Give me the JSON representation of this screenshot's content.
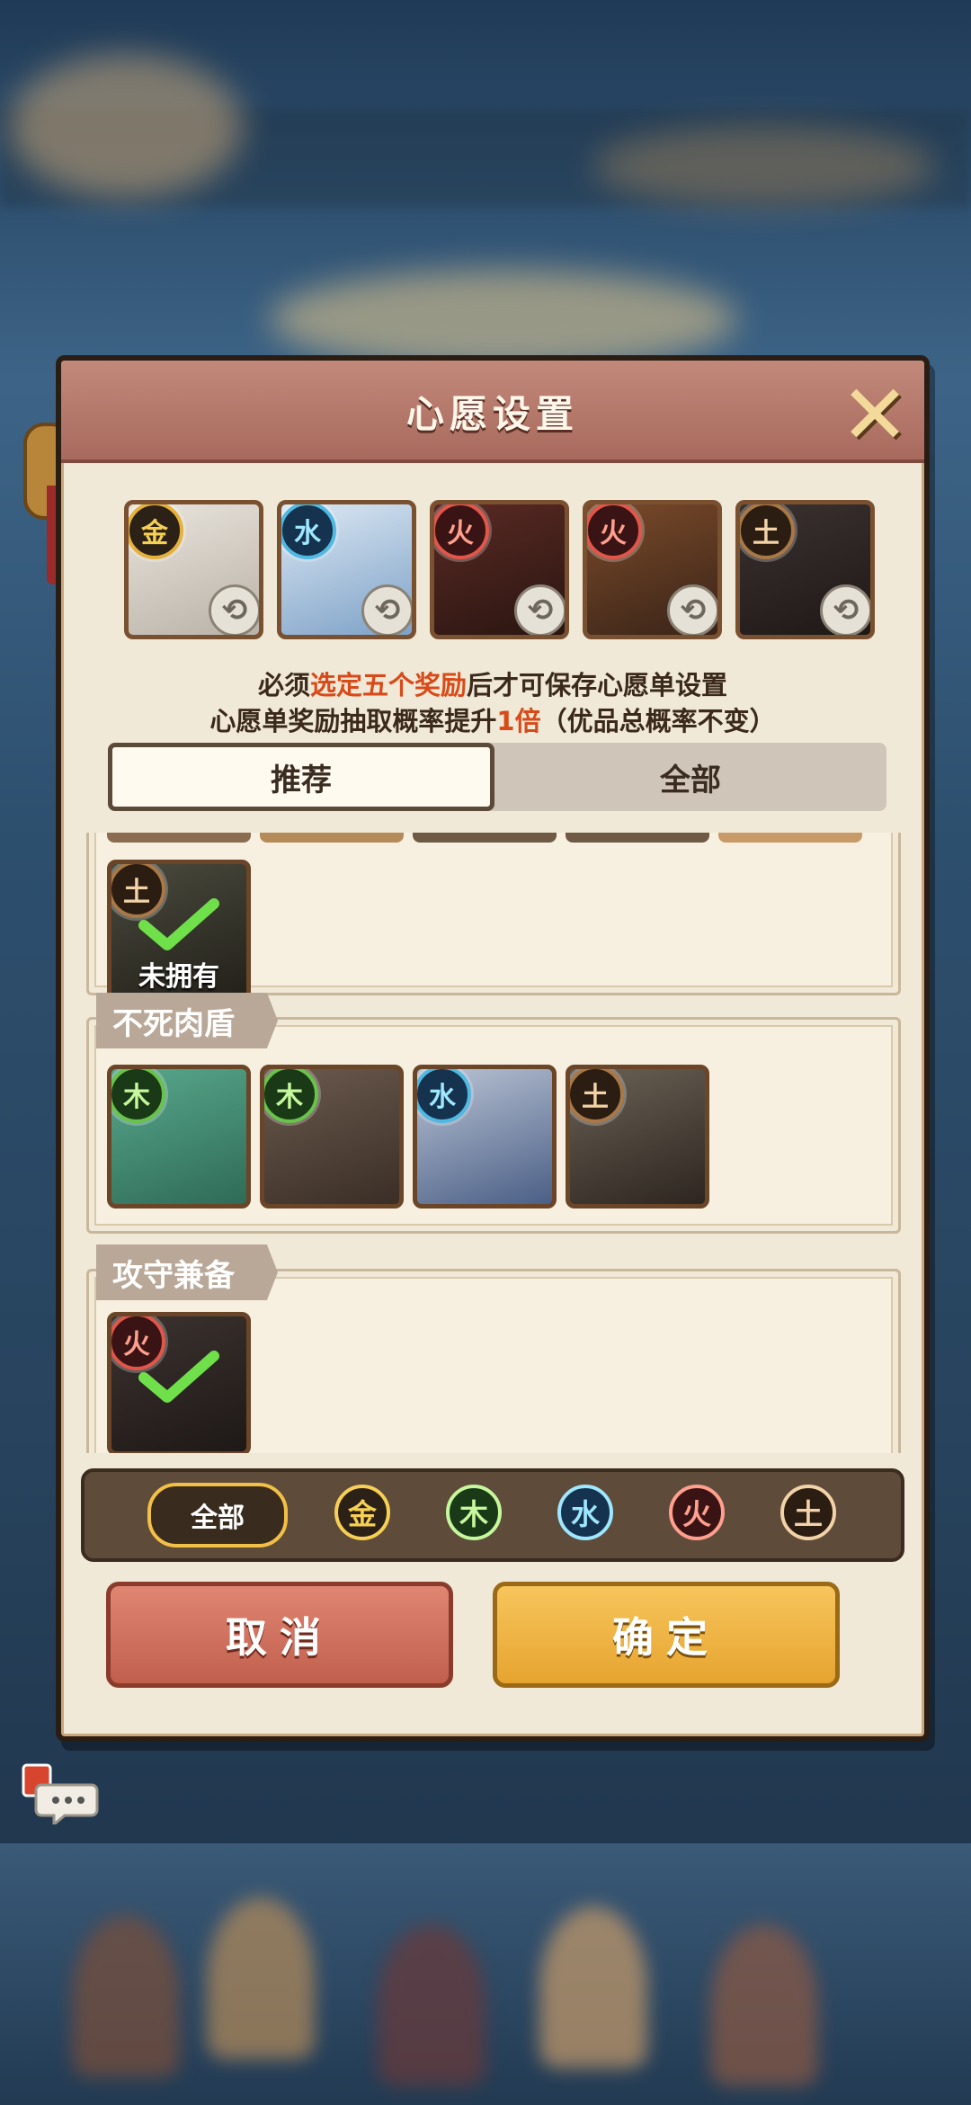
{
  "dialog": {
    "title": "心愿设置",
    "notice_line1_a": "必须",
    "notice_line1_hl": "选定五个奖励",
    "notice_line1_b": "后才可保存心愿单设置",
    "notice_line2_a": "心愿单奖励抽取概率提升",
    "notice_line2_hl": "1倍",
    "notice_line2_b": "（优品总概率不变）"
  },
  "selected_slots": [
    {
      "element": "金",
      "element_key": "gold",
      "colors": [
        "#e9e4dc",
        "#b9b2a8"
      ]
    },
    {
      "element": "水",
      "element_key": "water",
      "colors": [
        "#dce8f3",
        "#7da1c7"
      ]
    },
    {
      "element": "火",
      "element_key": "fire",
      "colors": [
        "#5a2a24",
        "#2a1511"
      ]
    },
    {
      "element": "火",
      "element_key": "fire",
      "colors": [
        "#7a4a2a",
        "#3a2418"
      ]
    },
    {
      "element": "土",
      "element_key": "earth",
      "colors": [
        "#3b3230",
        "#1e1816"
      ]
    }
  ],
  "tabs": [
    {
      "label": "推荐",
      "active": true
    },
    {
      "label": "全部",
      "active": false
    }
  ],
  "groups": [
    {
      "title": "",
      "heroes": [
        {
          "element": "土",
          "element_key": "earth",
          "selected": true,
          "owned_label": "未拥有",
          "colors": [
            "#4a4a3e",
            "#222019"
          ]
        }
      ]
    },
    {
      "title": "不死肉盾",
      "heroes": [
        {
          "element": "木",
          "element_key": "wood",
          "selected": false,
          "colors": [
            "#58a78b",
            "#2f6b58"
          ]
        },
        {
          "element": "木",
          "element_key": "wood",
          "selected": false,
          "colors": [
            "#6b5a4e",
            "#3a2e26"
          ]
        },
        {
          "element": "水",
          "element_key": "water",
          "selected": false,
          "colors": [
            "#b9c3d4",
            "#4b5f86"
          ]
        },
        {
          "element": "土",
          "element_key": "earth",
          "selected": false,
          "colors": [
            "#6a6155",
            "#2d2620"
          ]
        }
      ]
    },
    {
      "title": "攻守兼备",
      "heroes": [
        {
          "element": "火",
          "element_key": "fire",
          "selected": true,
          "colors": [
            "#3c3330",
            "#1e1816"
          ]
        }
      ]
    }
  ],
  "filters": {
    "all_label": "全部",
    "elements": [
      {
        "label": "金",
        "key": "gold"
      },
      {
        "label": "木",
        "key": "wood"
      },
      {
        "label": "水",
        "key": "water"
      },
      {
        "label": "火",
        "key": "fire"
      },
      {
        "label": "土",
        "key": "earth"
      }
    ]
  },
  "buttons": {
    "cancel": "取消",
    "confirm": "确定"
  },
  "icons": {
    "close": "close-icon",
    "swap": "swap-icon",
    "check": "check-icon",
    "chat": "chat-bubble-icon"
  }
}
